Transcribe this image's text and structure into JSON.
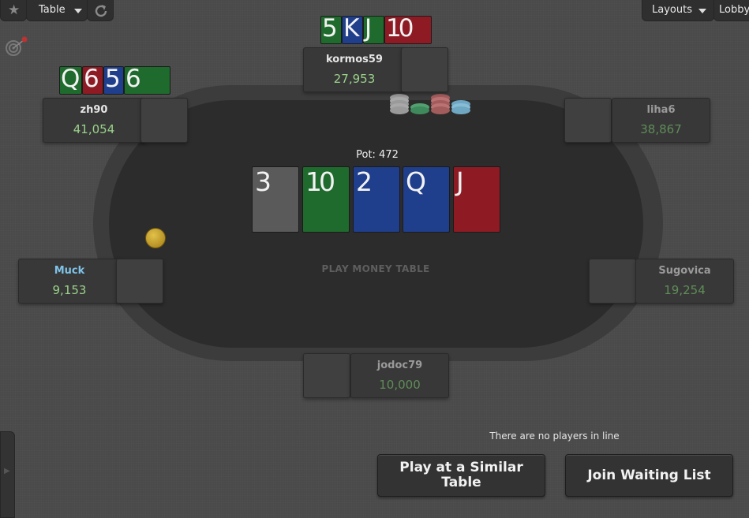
{
  "toolbar": {
    "table_label": "Table",
    "layouts_label": "Layouts",
    "lobby_label": "Lobby"
  },
  "table": {
    "pot_label": "Pot: 472",
    "play_money_label": "PLAY MONEY TABLE",
    "board": [
      {
        "rank": "3",
        "color": "gray"
      },
      {
        "rank": "10",
        "color": "green"
      },
      {
        "rank": "2",
        "color": "blue"
      },
      {
        "rank": "Q",
        "color": "blue"
      },
      {
        "rank": "J",
        "color": "red"
      }
    ]
  },
  "seats": {
    "kormos59": {
      "name": "kormos59",
      "stack": "27,953",
      "hand": [
        "5",
        "K",
        "J",
        "10"
      ]
    },
    "zh90": {
      "name": "zh90",
      "stack": "41,054",
      "hand": [
        "Q",
        "6",
        "5",
        "6"
      ]
    },
    "liha6": {
      "name": "liha6",
      "stack": "38,867"
    },
    "muck": {
      "name": "Muck",
      "stack": "9,153"
    },
    "sugovica": {
      "name": "Sugovica",
      "stack": "19,254"
    },
    "jodoc79": {
      "name": "jodoc79",
      "stack": "10,000"
    }
  },
  "waiting": {
    "no_players_text": "There are no players in line",
    "play_similar_label": "Play at a Similar Table",
    "join_waiting_label": "Join Waiting List"
  },
  "colors": {
    "felt": "#2c2c2c",
    "rail": "#3c3c3c",
    "stack_green": "#9bd28a",
    "muck_name": "#7ec3e8",
    "card_green": "#1f6b2d",
    "card_blue": "#1f3e8c",
    "card_red": "#8e1b24",
    "card_gray": "#5a5a5a"
  },
  "icons": [
    "star-icon",
    "caret-down-icon",
    "refresh-icon",
    "target-icon",
    "chevron-right-icon",
    "dealer-button-icon",
    "chip-stack-icon"
  ]
}
